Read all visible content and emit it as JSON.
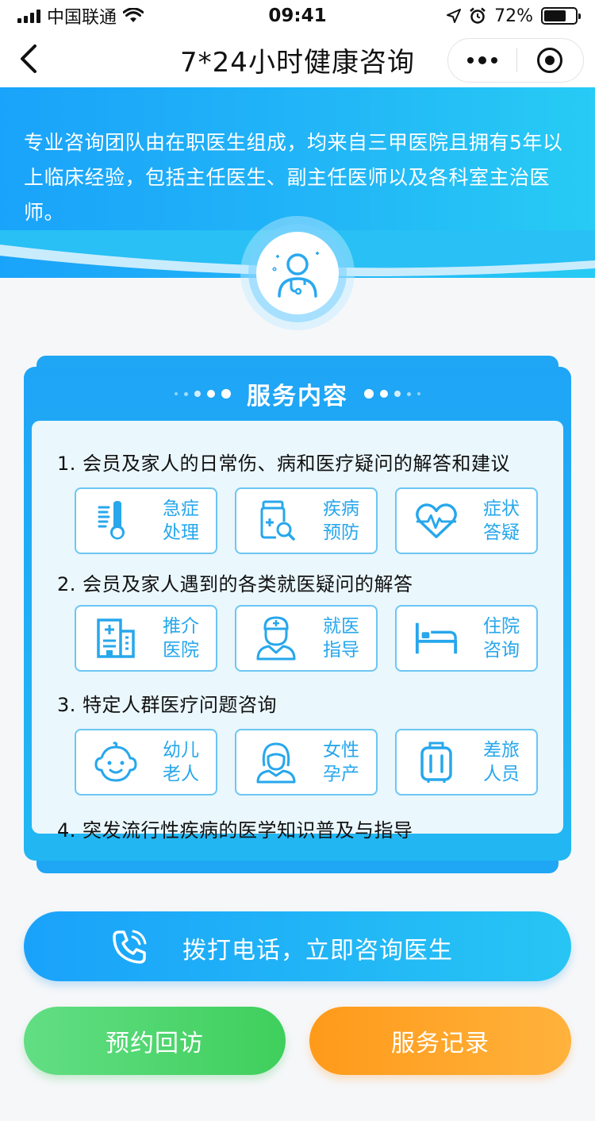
{
  "status_bar": {
    "carrier": "中国联通",
    "time": "09:41",
    "battery": "72%",
    "battery_level": 0.72
  },
  "nav": {
    "title": "7*24小时健康咨询"
  },
  "banner": {
    "description": "专业咨询团队由在职医生组成，均来自三甲医院且拥有5年以上临床经验，包括主任医生、副主任医师以及各科室主治医师。"
  },
  "service": {
    "title": "服务内容",
    "sections": [
      {
        "title": "1. 会员及家人的日常伤、病和医疗疑问的解答和建议",
        "tiles": [
          {
            "icon": "thermometer-icon",
            "line1": "急症",
            "line2": "处理"
          },
          {
            "icon": "medicine-bottle-icon",
            "line1": "疾病",
            "line2": "预防"
          },
          {
            "icon": "heart-pulse-icon",
            "line1": "症状",
            "line2": "答疑"
          }
        ]
      },
      {
        "title": "2. 会员及家人遇到的各类就医疑问的解答",
        "tiles": [
          {
            "icon": "hospital-building-icon",
            "line1": "推介",
            "line2": "医院"
          },
          {
            "icon": "nurse-icon",
            "line1": "就医",
            "line2": "指导"
          },
          {
            "icon": "hospital-bed-icon",
            "line1": "住院",
            "line2": "咨询"
          }
        ]
      },
      {
        "title": "3. 特定人群医疗问题咨询",
        "tiles": [
          {
            "icon": "baby-face-icon",
            "line1": "幼儿",
            "line2": "老人"
          },
          {
            "icon": "woman-icon",
            "line1": "女性",
            "line2": "孕产"
          },
          {
            "icon": "luggage-icon",
            "line1": "差旅",
            "line2": "人员"
          }
        ]
      },
      {
        "title": "4. 突发流行性疾病的医学知识普及与指导"
      }
    ]
  },
  "actions": {
    "call_label": "拨打电话，立即咨询医生",
    "callback_label": "预约回访",
    "records_label": "服务记录"
  },
  "colors": {
    "primary": "#1fa6f4",
    "tile_text": "#27a7ec",
    "green": "#48d466",
    "orange": "#ffa52a"
  }
}
